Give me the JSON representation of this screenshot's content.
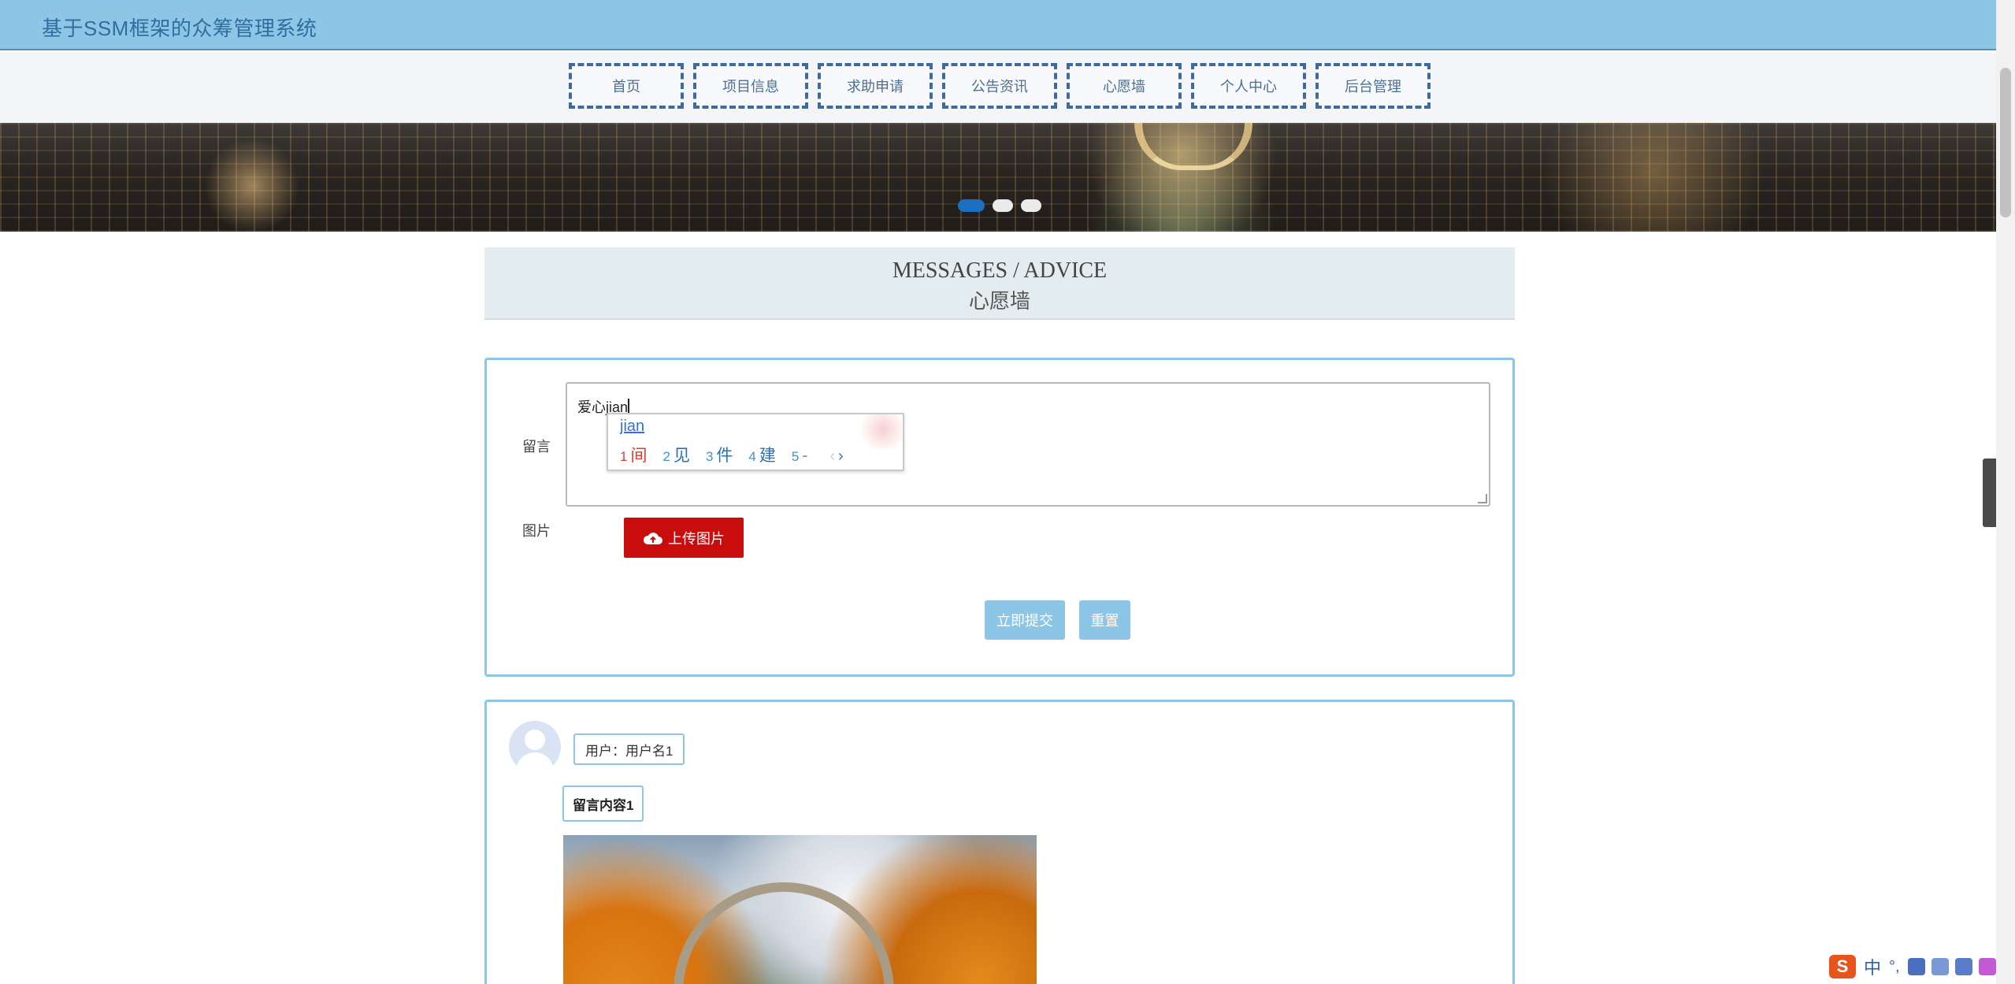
{
  "header": {
    "site_title": "基于SSM框架的众筹管理系统"
  },
  "nav": {
    "items": [
      "首页",
      "项目信息",
      "求助申请",
      "公告资讯",
      "心愿墙",
      "个人中心",
      "后台管理"
    ]
  },
  "banner": {
    "slide_count": 3,
    "active_slide": 1
  },
  "section": {
    "title_en": "MESSAGES / ADVICE",
    "title_cn": "心愿墙"
  },
  "form": {
    "message_label": "留言",
    "message_value": "爱心jian",
    "image_label": "图片",
    "upload_button": "上传图片",
    "submit_button": "立即提交",
    "reset_button": "重置"
  },
  "ime": {
    "composition": "jian",
    "candidates": [
      {
        "num": "1",
        "text": "间"
      },
      {
        "num": "2",
        "text": "见"
      },
      {
        "num": "3",
        "text": "件"
      },
      {
        "num": "4",
        "text": "建"
      },
      {
        "num": "5",
        "text": "-"
      }
    ],
    "prev_arrow": "‹",
    "next_arrow": "›",
    "selected_color": "#e03b2b",
    "candidate_color": "#2c6fb5",
    "status_logo": "S",
    "status_mode": "中",
    "status_punct": "°,"
  },
  "messages": [
    {
      "user_label": "用户：用户名1",
      "content": "留言内容1"
    }
  ],
  "colors": {
    "accent": "#8cc5e6",
    "nav_border": "#3f6b9c",
    "upload_red": "#c90c0c",
    "carousel_active": "#1c6fc0"
  },
  "icons": {
    "upload": "cloud-upload-icon",
    "side_tab": "chevron-left-icon",
    "text_cursor": "i-beam-cursor-icon",
    "avatar": "default-user-avatar-icon"
  },
  "side_tab": {
    "glyph": "‹"
  }
}
